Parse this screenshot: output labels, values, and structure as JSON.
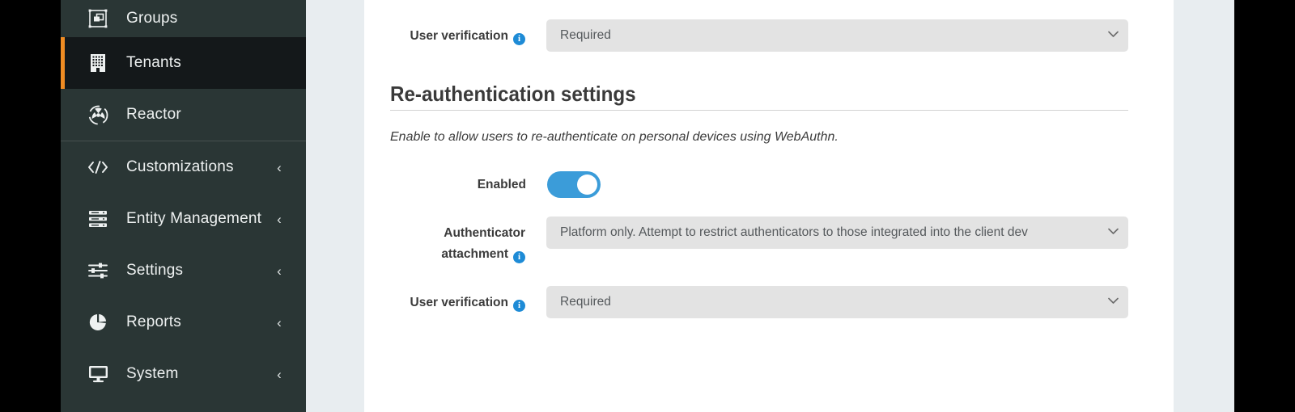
{
  "sidebar": {
    "items": [
      {
        "label": "Groups",
        "icon": "groups-icon",
        "active": false,
        "expandable": false
      },
      {
        "label": "Tenants",
        "icon": "tenants-icon",
        "active": true,
        "expandable": false
      },
      {
        "label": "Reactor",
        "icon": "reactor-icon",
        "active": false,
        "expandable": false
      },
      {
        "label": "Customizations",
        "icon": "code-icon",
        "active": false,
        "expandable": true
      },
      {
        "label": "Entity Management",
        "icon": "entity-management-icon",
        "active": false,
        "expandable": true
      },
      {
        "label": "Settings",
        "icon": "sliders-icon",
        "active": false,
        "expandable": true
      },
      {
        "label": "Reports",
        "icon": "pie-chart-icon",
        "active": false,
        "expandable": true
      },
      {
        "label": "System",
        "icon": "monitor-icon",
        "active": false,
        "expandable": true
      }
    ],
    "chevron_glyph": "‹",
    "active_accent_color": "#f08c23",
    "background_color": "#2a3635",
    "active_background_color": "#14181a"
  },
  "main": {
    "top_row": {
      "label": "User verification",
      "info_glyph": "i",
      "select_value": "Required"
    },
    "section": {
      "title": "Re-authentication settings",
      "description": "Enable to allow users to re-authenticate on personal devices using WebAuthn."
    },
    "enabled_row": {
      "label": "Enabled",
      "toggle_state": "on",
      "toggle_color": "#3b9cd9"
    },
    "attachment_row": {
      "label_line1": "Authenticator",
      "label_line2": "attachment",
      "info_glyph": "i",
      "select_value": "Platform only. Attempt to restrict authenticators to those integrated into the client dev"
    },
    "verification_row": {
      "label": "User verification",
      "info_glyph": "i",
      "select_value": "Required"
    }
  }
}
